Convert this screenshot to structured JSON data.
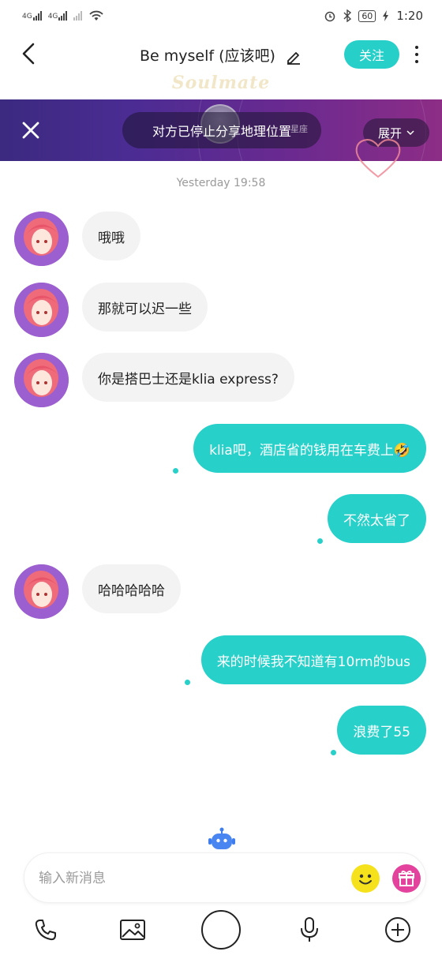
{
  "status_bar": {
    "sim1": "4G",
    "sim2": "4G",
    "battery": "60",
    "time": "1:20"
  },
  "header": {
    "title": "Be myself (应该吧)",
    "follow_label": "关注",
    "brand": "Soulmate"
  },
  "banner": {
    "message": "对方已停止分享地理位置",
    "hint": "星座",
    "expand_label": "展开"
  },
  "chat": {
    "timestamp": "Yesterday 19:58",
    "messages": [
      {
        "from": "them",
        "text": "哦哦"
      },
      {
        "from": "them",
        "text": "那就可以迟一些"
      },
      {
        "from": "them",
        "text": "你是搭巴士还是klia express?"
      },
      {
        "from": "me",
        "text": "klia吧，酒店省的钱用在车费上🤣"
      },
      {
        "from": "me",
        "text": "不然太省了"
      },
      {
        "from": "them",
        "text": "哈哈哈哈哈"
      },
      {
        "from": "me",
        "text": "来的时候我不知道有10rm的bus"
      },
      {
        "from": "me",
        "text": "浪费了55"
      }
    ]
  },
  "composer": {
    "placeholder": "输入新消息"
  },
  "icons": {
    "back": "chevron-left-icon",
    "edit": "pencil-icon",
    "more": "more-vertical-icon",
    "close": "close-icon",
    "phone": "phone-icon",
    "image": "image-icon",
    "camera": "camera-shutter-icon",
    "mic": "microphone-icon",
    "add": "plus-circle-icon",
    "emoji": "emoji-icon",
    "gift": "gift-icon",
    "robot": "robot-icon"
  },
  "colors": {
    "accent": "#27d0c9",
    "incoming_bubble": "#f3f3f3",
    "avatar_bg": "#9b5fd0"
  }
}
